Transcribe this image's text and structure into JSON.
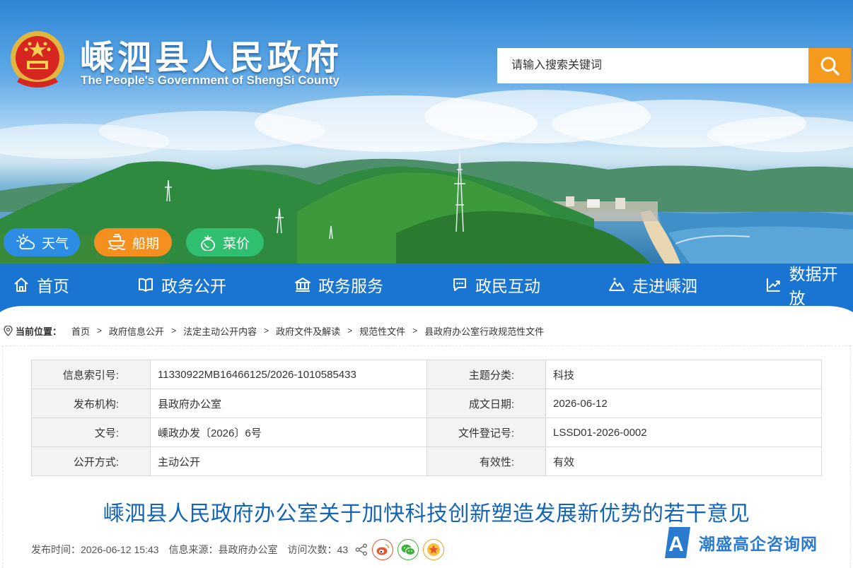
{
  "header": {
    "site_title": "嵊泗县人民政府",
    "site_subtitle": "The People's Government of ShengSi County",
    "search_placeholder": "请输入搜索关键词"
  },
  "quick_links": [
    {
      "label": "天气",
      "icon": "weather-icon",
      "color": "#2d8de4"
    },
    {
      "label": "船期",
      "icon": "ship-icon",
      "color": "#f59020"
    },
    {
      "label": "菜价",
      "icon": "vegetable-icon",
      "color": "#2fbf6e"
    }
  ],
  "nav": [
    {
      "label": "首页",
      "icon": "home-icon"
    },
    {
      "label": "政务公开",
      "icon": "book-icon"
    },
    {
      "label": "政务服务",
      "icon": "government-building-icon"
    },
    {
      "label": "政民互动",
      "icon": "chat-icon"
    },
    {
      "label": "走进嵊泗",
      "icon": "mountain-icon"
    },
    {
      "label": "数据开放",
      "icon": "chart-icon"
    }
  ],
  "breadcrumb": {
    "label": "当前位置：",
    "items": [
      "首页",
      "政府信息公开",
      "法定主动公开内容",
      "政府文件及解读",
      "规范性文件",
      "县政府办公室行政规范性文件"
    ]
  },
  "meta": {
    "rows": [
      {
        "k1": "信息索引号:",
        "v1": "11330922MB16466125/2026-1010585433",
        "k2": "主题分类:",
        "v2": "科技"
      },
      {
        "k1": "发布机构:",
        "v1": "县政府办公室",
        "k2": "成文日期:",
        "v2": "2026-06-12"
      },
      {
        "k1": "文号:",
        "v1": "嵊政办发〔2026〕6号",
        "k2": "文件登记号:",
        "v2": "LSSD01-2026-0002"
      },
      {
        "k1": "公开方式:",
        "v1": "主动公开",
        "k2": "有效性:",
        "v2": "有效"
      }
    ]
  },
  "document": {
    "title": "嵊泗县人民政府办公室关于加快科技创新塑造发展新优势的若干意见",
    "publish_label": "发布时间：",
    "publish_time": "2026-06-12 15:43",
    "source_label": "信息来源：",
    "source": "县政府办公室",
    "visits_label": "访问次数：",
    "visits": "43"
  },
  "share": [
    {
      "icon": "weibo-icon",
      "color": "#e8542c"
    },
    {
      "icon": "wechat-icon",
      "color": "#3fb03b"
    },
    {
      "icon": "favorite-star-icon",
      "color": "#f0a020"
    }
  ],
  "watermark": {
    "text": "潮盛高企咨询网",
    "letter": "A"
  },
  "colors": {
    "nav_blue": "#1a74d1",
    "title_blue": "#1565b7",
    "search_orange": "#f69a1e"
  }
}
